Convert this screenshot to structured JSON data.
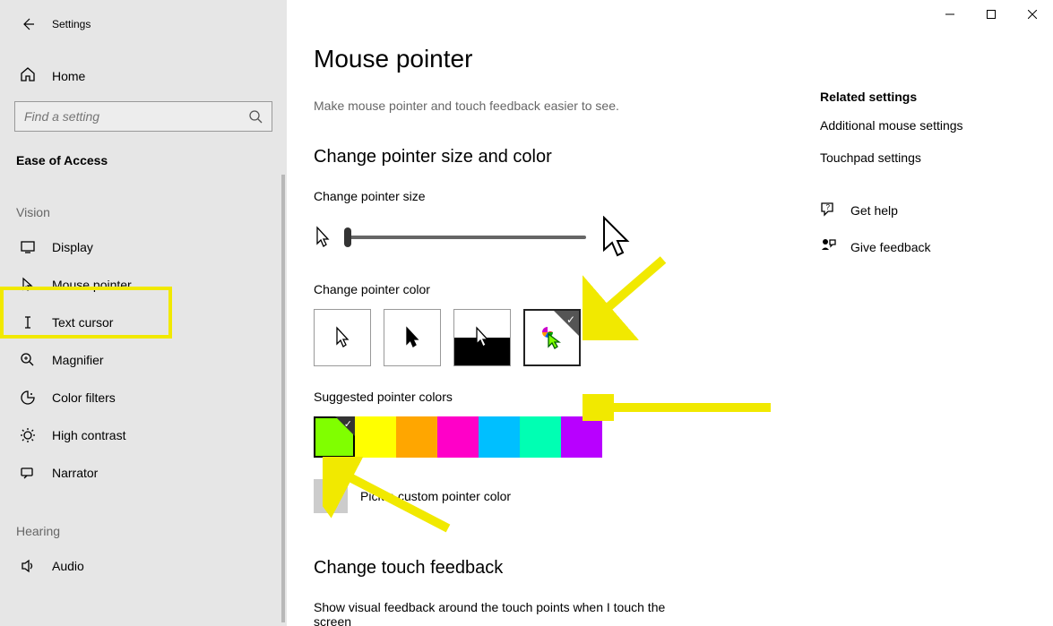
{
  "window": {
    "title": "Settings"
  },
  "sidebar": {
    "home": "Home",
    "search_placeholder": "Find a setting",
    "category": "Ease of Access",
    "groups": {
      "vision": "Vision",
      "hearing": "Hearing"
    },
    "items": {
      "display": "Display",
      "mouse_pointer": "Mouse pointer",
      "text_cursor": "Text cursor",
      "magnifier": "Magnifier",
      "color_filters": "Color filters",
      "high_contrast": "High contrast",
      "narrator": "Narrator",
      "audio": "Audio"
    }
  },
  "main": {
    "title": "Mouse pointer",
    "subtitle": "Make mouse pointer and touch feedback easier to see.",
    "section_size_color": "Change pointer size and color",
    "label_size": "Change pointer size",
    "label_color": "Change pointer color",
    "label_suggested": "Suggested pointer colors",
    "label_custom": "Pick a custom pointer color",
    "section_touch": "Change touch feedback",
    "touch_desc": "Show visual feedback around the touch points when I touch the screen",
    "colors": [
      "#80ff00",
      "#ffff00",
      "#ffa600",
      "#ff00c8",
      "#00bfff",
      "#00ffb3",
      "#b800ff"
    ]
  },
  "side": {
    "related": "Related settings",
    "link1": "Additional mouse settings",
    "link2": "Touchpad settings",
    "help": "Get help",
    "feedback": "Give feedback"
  }
}
